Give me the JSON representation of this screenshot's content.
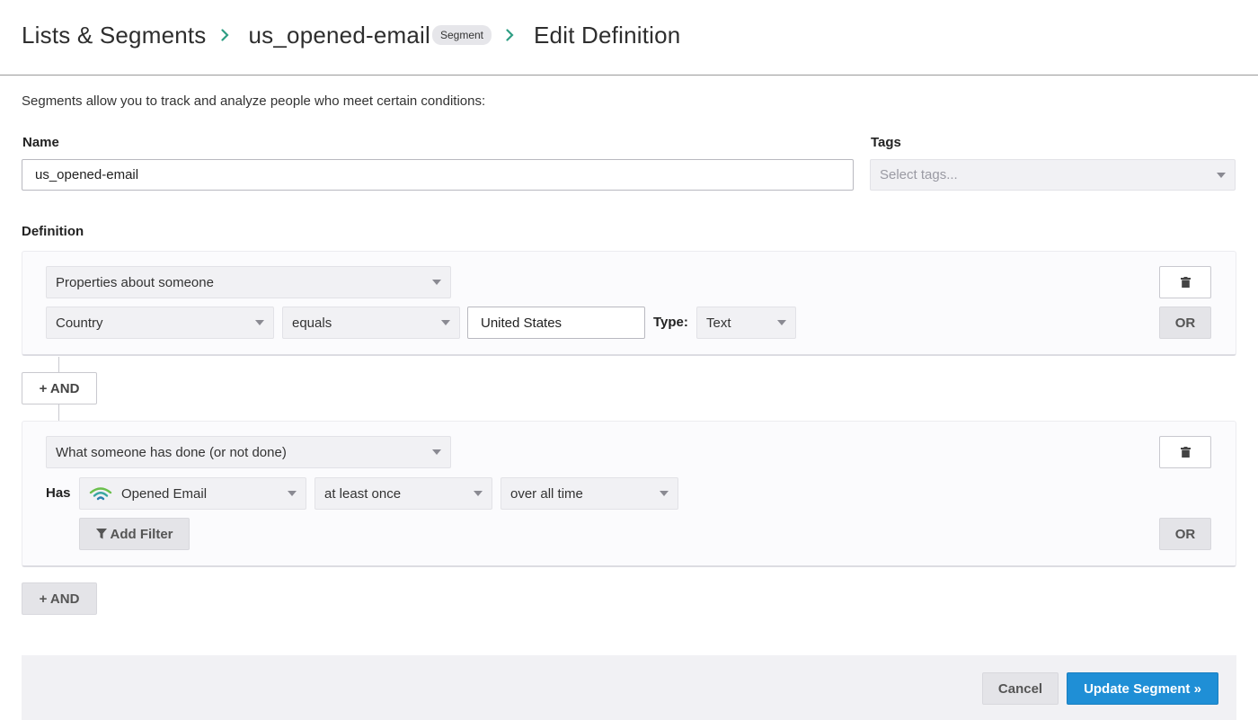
{
  "breadcrumb": {
    "root": "Lists & Segments",
    "segment_name": "us_opened-email",
    "segment_badge": "Segment",
    "current": "Edit Definition"
  },
  "intro_text": "Segments allow you to track and analyze people who meet certain conditions:",
  "name_field": {
    "label": "Name",
    "value": "us_opened-email"
  },
  "tags_field": {
    "label": "Tags",
    "placeholder": "Select tags..."
  },
  "definition": {
    "label": "Definition",
    "condition_1": {
      "type_select": "Properties about someone",
      "property_select": "Country",
      "operator_select": "equals",
      "value": "United States",
      "type_label": "Type:",
      "type_value": "Text",
      "or_label": "OR"
    },
    "and_button_1": "+ AND",
    "condition_2": {
      "type_select": "What someone has done (or not done)",
      "has_label": "Has",
      "event_select": "Opened Email",
      "frequency_select": "at least once",
      "timeframe_select": "over all time",
      "add_filter_label": "Add Filter",
      "or_label": "OR"
    },
    "and_button_2": "+ AND"
  },
  "footer": {
    "cancel_label": "Cancel",
    "submit_label": "Update Segment »"
  },
  "colors": {
    "accent_green": "#2f9e84",
    "primary_blue": "#1f8fd6"
  },
  "icons": {
    "breadcrumb_separator": "chevron-right-icon",
    "delete": "trash-icon",
    "event": "opened-email-wifi-icon",
    "filter": "filter-icon"
  }
}
